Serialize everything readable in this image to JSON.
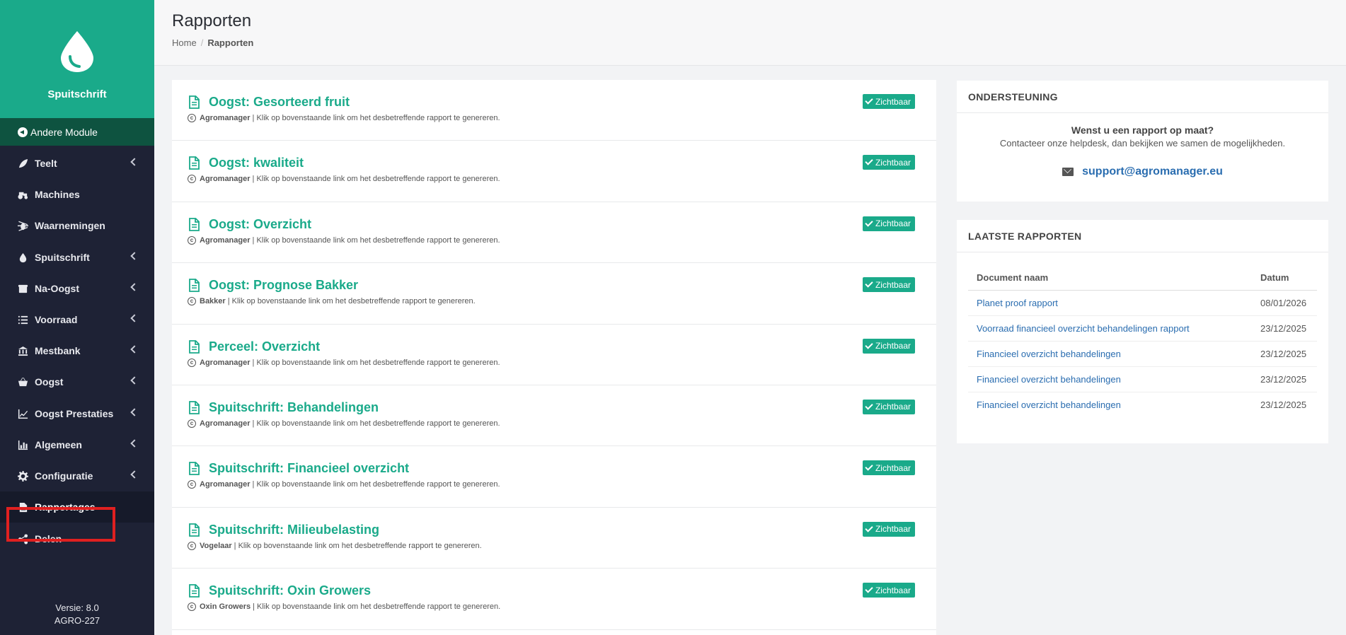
{
  "sidebar": {
    "brand_name": "Spuitschrift",
    "module_button": "Andere Module",
    "items": [
      {
        "label": "Teelt",
        "icon": "leaf-icon",
        "chevron": true
      },
      {
        "label": "Machines",
        "icon": "tractor-icon",
        "chevron": false
      },
      {
        "label": "Waarnemingen",
        "icon": "bug-icon",
        "chevron": false
      },
      {
        "label": "Spuitschrift",
        "icon": "droplet-icon",
        "chevron": true
      },
      {
        "label": "Na-Oogst",
        "icon": "box-icon",
        "chevron": true
      },
      {
        "label": "Voorraad",
        "icon": "list-icon",
        "chevron": true
      },
      {
        "label": "Mestbank",
        "icon": "bank-icon",
        "chevron": true
      },
      {
        "label": "Oogst",
        "icon": "basket-icon",
        "chevron": true
      },
      {
        "label": "Oogst Prestaties",
        "icon": "line-chart-icon",
        "chevron": true
      },
      {
        "label": "Algemeen",
        "icon": "bar-chart-icon",
        "chevron": true
      },
      {
        "label": "Configuratie",
        "icon": "gear-icon",
        "chevron": true
      },
      {
        "label": "Rapportages",
        "icon": "document-icon",
        "chevron": false,
        "active": true
      },
      {
        "label": "Delen",
        "icon": "share-icon",
        "chevron": false
      }
    ],
    "version_line1": "Versie: 8.0",
    "version_line2": "AGRO-227"
  },
  "header": {
    "title": "Rapporten",
    "breadcrumb": [
      "Home",
      "Rapporten"
    ]
  },
  "reports": [
    {
      "title": "Oogst: Gesorteerd fruit",
      "author": "Agromanager",
      "desc": "| Klik op bovenstaande link om het desbetreffende rapport te genereren.",
      "badge": "Zichtbaar"
    },
    {
      "title": "Oogst: kwaliteit",
      "author": "Agromanager",
      "desc": "| Klik op bovenstaande link om het desbetreffende rapport te genereren.",
      "badge": "Zichtbaar"
    },
    {
      "title": "Oogst: Overzicht",
      "author": "Agromanager",
      "desc": "| Klik op bovenstaande link om het desbetreffende rapport te genereren.",
      "badge": "Zichtbaar"
    },
    {
      "title": "Oogst: Prognose Bakker",
      "author": "Bakker",
      "desc": "| Klik op bovenstaande link om het desbetreffende rapport te genereren.",
      "badge": "Zichtbaar"
    },
    {
      "title": "Perceel: Overzicht",
      "author": "Agromanager",
      "desc": "| Klik op bovenstaande link om het desbetreffende rapport te genereren.",
      "badge": "Zichtbaar"
    },
    {
      "title": "Spuitschrift: Behandelingen",
      "author": "Agromanager",
      "desc": "| Klik op bovenstaande link om het desbetreffende rapport te genereren.",
      "badge": "Zichtbaar"
    },
    {
      "title": "Spuitschrift: Financieel overzicht",
      "author": "Agromanager",
      "desc": "| Klik op bovenstaande link om het desbetreffende rapport te genereren.",
      "badge": "Zichtbaar"
    },
    {
      "title": "Spuitschrift: Milieubelasting",
      "author": "Vogelaar",
      "desc": "| Klik op bovenstaande link om het desbetreffende rapport te genereren.",
      "badge": "Zichtbaar"
    },
    {
      "title": "Spuitschrift: Oxin Growers",
      "author": "Oxin Growers",
      "desc": "| Klik op bovenstaande link om het desbetreffende rapport te genereren.",
      "badge": "Zichtbaar"
    }
  ],
  "support": {
    "heading": "ONDERSTEUNING",
    "question": "Wenst u een rapport op maat?",
    "contact": "Contacteer onze helpdesk, dan bekijken we samen de mogelijkheden.",
    "email": "support@agromanager.eu"
  },
  "latest": {
    "heading": "LAATSTE RAPPORTEN",
    "col_name": "Document naam",
    "col_date": "Datum",
    "rows": [
      {
        "name": "Planet proof rapport",
        "date": "08/01/2026"
      },
      {
        "name": "Voorraad financieel overzicht behandelingen rapport",
        "date": "23/12/2025"
      },
      {
        "name": "Financieel overzicht behandelingen",
        "date": "23/12/2025"
      },
      {
        "name": "Financieel overzicht behandelingen",
        "date": "23/12/2025"
      },
      {
        "name": "Financieel overzicht behandelingen",
        "date": "23/12/2025"
      }
    ]
  },
  "colors": {
    "accent": "#1aaa8a",
    "sidebar": "#1e2235",
    "module_bg": "#0e5340",
    "link": "#2a6db0",
    "highlight": "#e02020"
  }
}
